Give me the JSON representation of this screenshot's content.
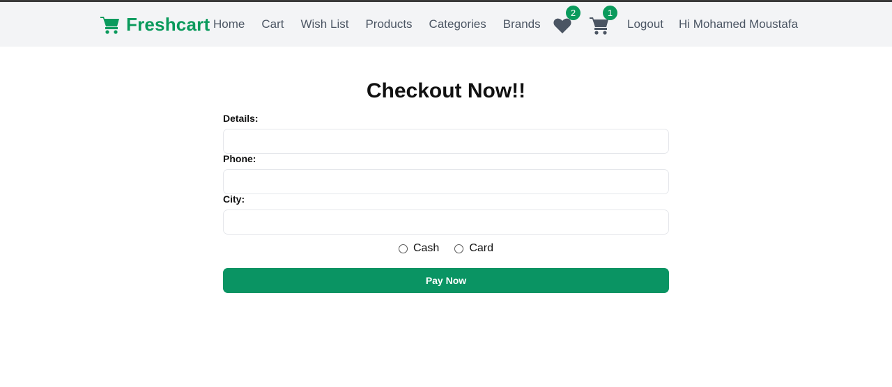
{
  "navbar": {
    "brand": "Freshcart",
    "links": [
      "Home",
      "Cart",
      "Wish List",
      "Products",
      "Categories",
      "Brands"
    ],
    "wishlist_count": "2",
    "cart_count": "1",
    "logout": "Logout",
    "greeting": "Hi Mohamed Moustafa",
    "brand_color": "#0a9a5c",
    "icon_color": "#4b5563"
  },
  "checkout": {
    "title": "Checkout Now!!",
    "fields": {
      "details_label": "Details:",
      "details_value": "",
      "phone_label": "Phone:",
      "phone_value": "",
      "city_label": "City:",
      "city_value": ""
    },
    "payment_options": [
      "Cash",
      "Card"
    ],
    "submit_label": "Pay Now",
    "button_color": "#0a9463"
  }
}
